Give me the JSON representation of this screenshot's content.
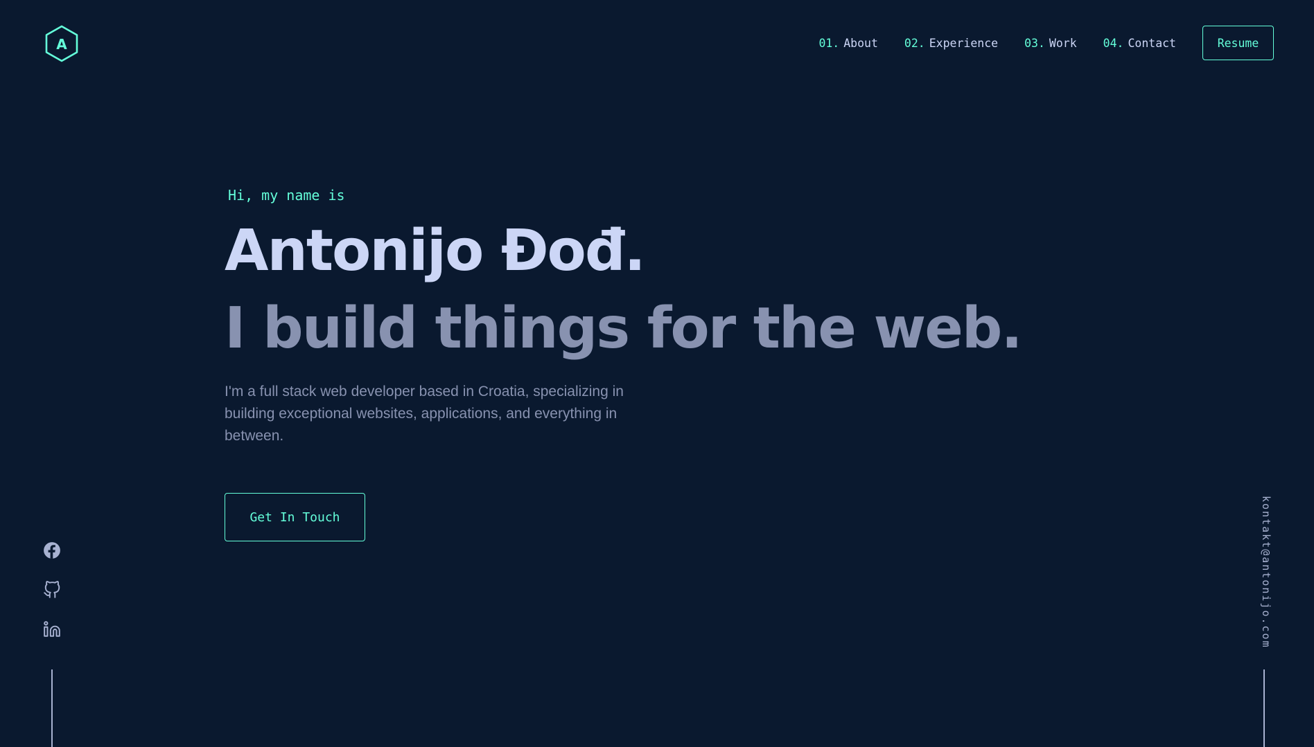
{
  "header": {
    "logo_letter": "A",
    "nav": [
      {
        "num": "01.",
        "label": "About"
      },
      {
        "num": "02.",
        "label": "Experience"
      },
      {
        "num": "03.",
        "label": "Work"
      },
      {
        "num": "04.",
        "label": "Contact"
      }
    ],
    "resume_label": "Resume"
  },
  "hero": {
    "greeting": "Hi, my name is",
    "name": "Antonijo Đođ.",
    "tagline": "I build things for the web.",
    "intro": "I'm a full stack web developer based in Croatia, specializing in building exceptional websites, applications, and everything in between.",
    "cta_label": "Get In Touch"
  },
  "social": {
    "icons": [
      "facebook-icon",
      "github-icon",
      "linkedin-icon"
    ]
  },
  "email": "kontakt@antonijo.com",
  "colors": {
    "background": "#0a192f",
    "accent": "#64ffda",
    "heading": "#ccd6f6",
    "text": "#8892b0",
    "line": "#a8b2d1"
  }
}
